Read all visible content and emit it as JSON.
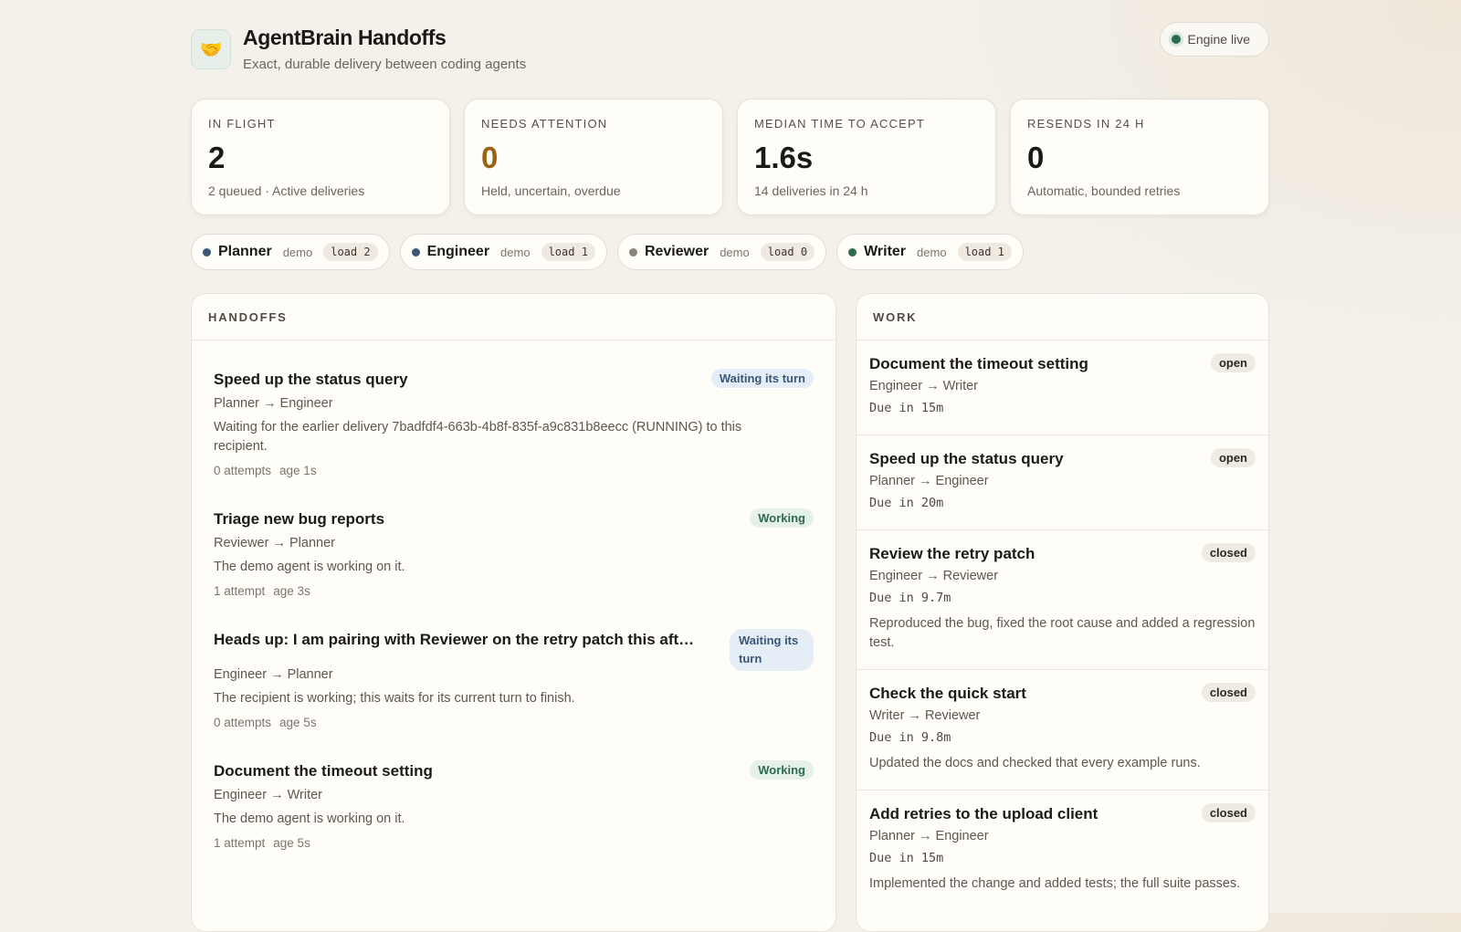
{
  "header": {
    "logo_icon": "🤝",
    "title": "AgentBrain Handoffs",
    "subtitle": "Exact, durable delivery between coding agents",
    "engine_status": "Engine live"
  },
  "stats": [
    {
      "label": "IN FLIGHT",
      "value": "2",
      "note": "2 queued · Active deliveries"
    },
    {
      "label": "NEEDS ATTENTION",
      "value": "0",
      "note": "Held, uncertain, overdue"
    },
    {
      "label": "MEDIAN TIME TO ACCEPT",
      "value": "1.6s",
      "note": "14 deliveries in 24 h"
    },
    {
      "label": "RESENDS IN 24 H",
      "value": "0",
      "note": "Automatic, bounded retries"
    }
  ],
  "agents": [
    {
      "name": "Planner",
      "tag": "demo",
      "load": "load 2",
      "color": "#3b5676"
    },
    {
      "name": "Engineer",
      "tag": "demo",
      "load": "load 1",
      "color": "#3b5676"
    },
    {
      "name": "Reviewer",
      "tag": "demo",
      "load": "load 0",
      "color": "#8a857c"
    },
    {
      "name": "Writer",
      "tag": "demo",
      "load": "load 1",
      "color": "#2f6b4e"
    }
  ],
  "handoffs": {
    "heading": "HANDOFFS",
    "items": [
      {
        "title": "Speed up the status query",
        "status": "Waiting its turn",
        "route": "Planner → Engineer",
        "desc": "Waiting for the earlier delivery 7badfdf4-663b-4b8f-835f-a9c831b8eecc (RUNNING) to this recipient.",
        "attempts": "0 attempts",
        "age": "age 1s"
      },
      {
        "title": "Triage new bug reports",
        "status": "Working",
        "route": "Reviewer → Planner",
        "desc": "The demo agent is working on it.",
        "attempts": "1 attempt",
        "age": "age 3s"
      },
      {
        "title": "Heads up: I am pairing with Reviewer on the retry patch this afternoon",
        "status": "Waiting its turn",
        "route": "Engineer → Planner",
        "desc": "The recipient is working; this waits for its current turn to finish.",
        "attempts": "0 attempts",
        "age": "age 5s"
      },
      {
        "title": "Document the timeout setting",
        "status": "Working",
        "route": "Engineer → Writer",
        "desc": "The demo agent is working on it.",
        "attempts": "1 attempt",
        "age": "age 5s"
      }
    ]
  },
  "work": {
    "heading": "WORK",
    "items": [
      {
        "title": "Document the timeout setting",
        "status": "open",
        "route": "Engineer → Writer",
        "due": "Due in 15m",
        "note": ""
      },
      {
        "title": "Speed up the status query",
        "status": "open",
        "route": "Planner → Engineer",
        "due": "Due in 20m",
        "note": ""
      },
      {
        "title": "Review the retry patch",
        "status": "closed",
        "route": "Engineer → Reviewer",
        "due": "Due in 9.7m",
        "note": "Reproduced the bug, fixed the root cause and added a regression test."
      },
      {
        "title": "Check the quick start",
        "status": "closed",
        "route": "Writer → Reviewer",
        "due": "Due in 9.8m",
        "note": "Updated the docs and checked that every example runs."
      },
      {
        "title": "Add retries to the upload client",
        "status": "closed",
        "route": "Planner → Engineer",
        "due": "Due in 15m",
        "note": "Implemented the change and added tests; the full suite passes."
      }
    ]
  }
}
